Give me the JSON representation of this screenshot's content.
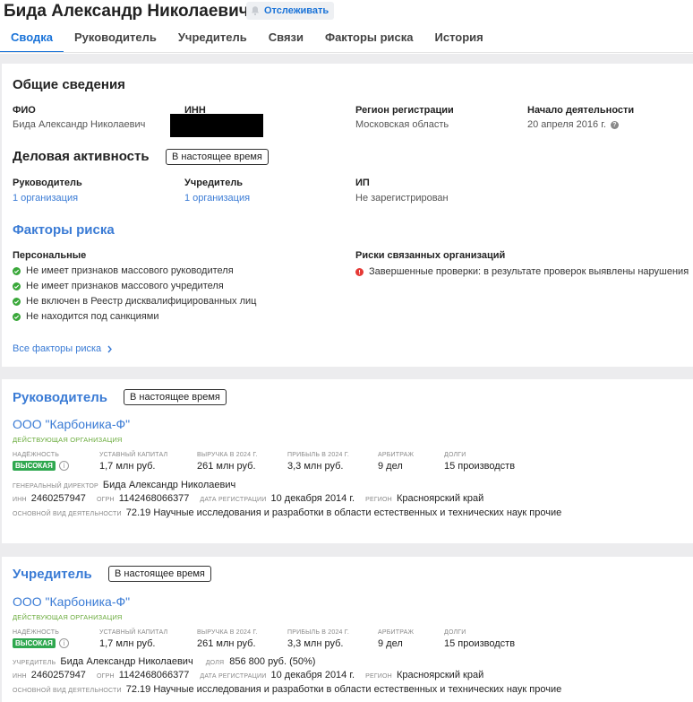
{
  "header": {
    "title": "Бида Александр Николаевич",
    "follow_label": "Отслеживать",
    "tabs": [
      "Сводка",
      "Руководитель",
      "Учредитель",
      "Связи",
      "Факторы риска",
      "История"
    ]
  },
  "general": {
    "section_title": "Общие сведения",
    "fio_label": "ФИО",
    "fio_value": "Бида Александр Николаевич",
    "inn_label": "ИНН",
    "region_label": "Регион регистрации",
    "region_value": "Московская область",
    "start_label": "Начало деятельности",
    "start_value": "20 апреля 2016 г."
  },
  "activity": {
    "section_title": "Деловая активность",
    "badge": "В настоящее время",
    "director_label": "Руководитель",
    "director_value": "1 организация",
    "founder_label": "Учредитель",
    "founder_value": "1 организация",
    "ip_label": "ИП",
    "ip_value": "Не зарегистрирован"
  },
  "risks": {
    "section_title": "Факторы риска",
    "personal_label": "Персональные",
    "personal_items": [
      "Не имеет признаков массового руководителя",
      "Не имеет признаков массового учредителя",
      "Не включен в Реестр дисквалифицированных лиц",
      "Не находится под санкциями"
    ],
    "related_label": "Риски связанных организаций",
    "related_items": [
      "Завершенные проверки: в результате проверок выявлены нарушения"
    ],
    "all_link": "Все факторы риска"
  },
  "director_card": {
    "title": "Руководитель",
    "badge": "В настоящее время",
    "org_name": "ООО \"Карбоника-Ф\"",
    "org_status": "ДЕЙСТВУЮЩАЯ ОРГАНИЗАЦИЯ",
    "reliability_label": "НАДЁЖНОСТЬ",
    "reliability_value": "ВЫСОКАЯ",
    "capital_label": "УСТАВНЫЙ КАПИТАЛ",
    "capital_value": "1,7 млн руб.",
    "revenue_label": "ВЫРУЧКА В 2024 Г.",
    "revenue_value": "261 млн руб.",
    "profit_label": "ПРИБЫЛЬ В 2024 Г.",
    "profit_value": "3,3 млн руб.",
    "arbitration_label": "АРБИТРАЖ",
    "arbitration_value": "9 дел",
    "debts_label": "ДОЛГИ",
    "debts_value": "15 производств",
    "person_label": "ГЕНЕРАЛЬНЫЙ ДИРЕКТОР",
    "person_value": "Бида Александр Николаевич",
    "inn_label": "ИНН",
    "inn_value": "2460257947",
    "ogrn_label": "ОГРН",
    "ogrn_value": "1142468066377",
    "regdate_label": "ДАТА РЕГИСТРАЦИИ",
    "regdate_value": "10 декабря 2014 г.",
    "region_label": "РЕГИОН",
    "region_value": "Красноярский край",
    "okved_label": "ОСНОВНОЙ ВИД ДЕЯТЕЛЬНОСТИ",
    "okved_value": "72.19 Научные исследования и разработки в области естественных и технических наук прочие"
  },
  "founder_card": {
    "title": "Учредитель",
    "badge": "В настоящее время",
    "org_name": "ООО \"Карбоника-Ф\"",
    "org_status": "ДЕЙСТВУЮЩАЯ ОРГАНИЗАЦИЯ",
    "reliability_label": "НАДЁЖНОСТЬ",
    "reliability_value": "ВЫСОКАЯ",
    "capital_label": "УСТАВНЫЙ КАПИТАЛ",
    "capital_value": "1,7 млн руб.",
    "revenue_label": "ВЫРУЧКА В 2024 Г.",
    "revenue_value": "261 млн руб.",
    "profit_label": "ПРИБЫЛЬ В 2024 Г.",
    "profit_value": "3,3 млн руб.",
    "arbitration_label": "АРБИТРАЖ",
    "arbitration_value": "9 дел",
    "debts_label": "ДОЛГИ",
    "debts_value": "15 производств",
    "person_label": "УЧРЕДИТЕЛЬ",
    "person_value": "Бида Александр Николаевич",
    "share_label": "ДОЛЯ",
    "share_value": "856 800 руб. (50%)",
    "inn_label": "ИНН",
    "inn_value": "2460257947",
    "ogrn_label": "ОГРН",
    "ogrn_value": "1142468066377",
    "regdate_label": "ДАТА РЕГИСТРАЦИИ",
    "regdate_value": "10 декабря 2014 г.",
    "region_label": "РЕГИОН",
    "region_value": "Красноярский край",
    "okved_label": "ОСНОВНОЙ ВИД ДЕЯТЕЛЬНОСТИ",
    "okved_value": "72.19 Научные исследования и разработки в области естественных и технических наук прочие"
  },
  "colors": {
    "accent": "#1a73d8",
    "link": "#3a7bd5",
    "ok": "#3aa83a",
    "warn": "#e53935",
    "badge_green": "#2fa84f"
  },
  "icons": [
    "bell-icon",
    "check-circle-icon",
    "alert-circle-icon",
    "chevron-right-icon",
    "info-icon",
    "question-icon"
  ]
}
